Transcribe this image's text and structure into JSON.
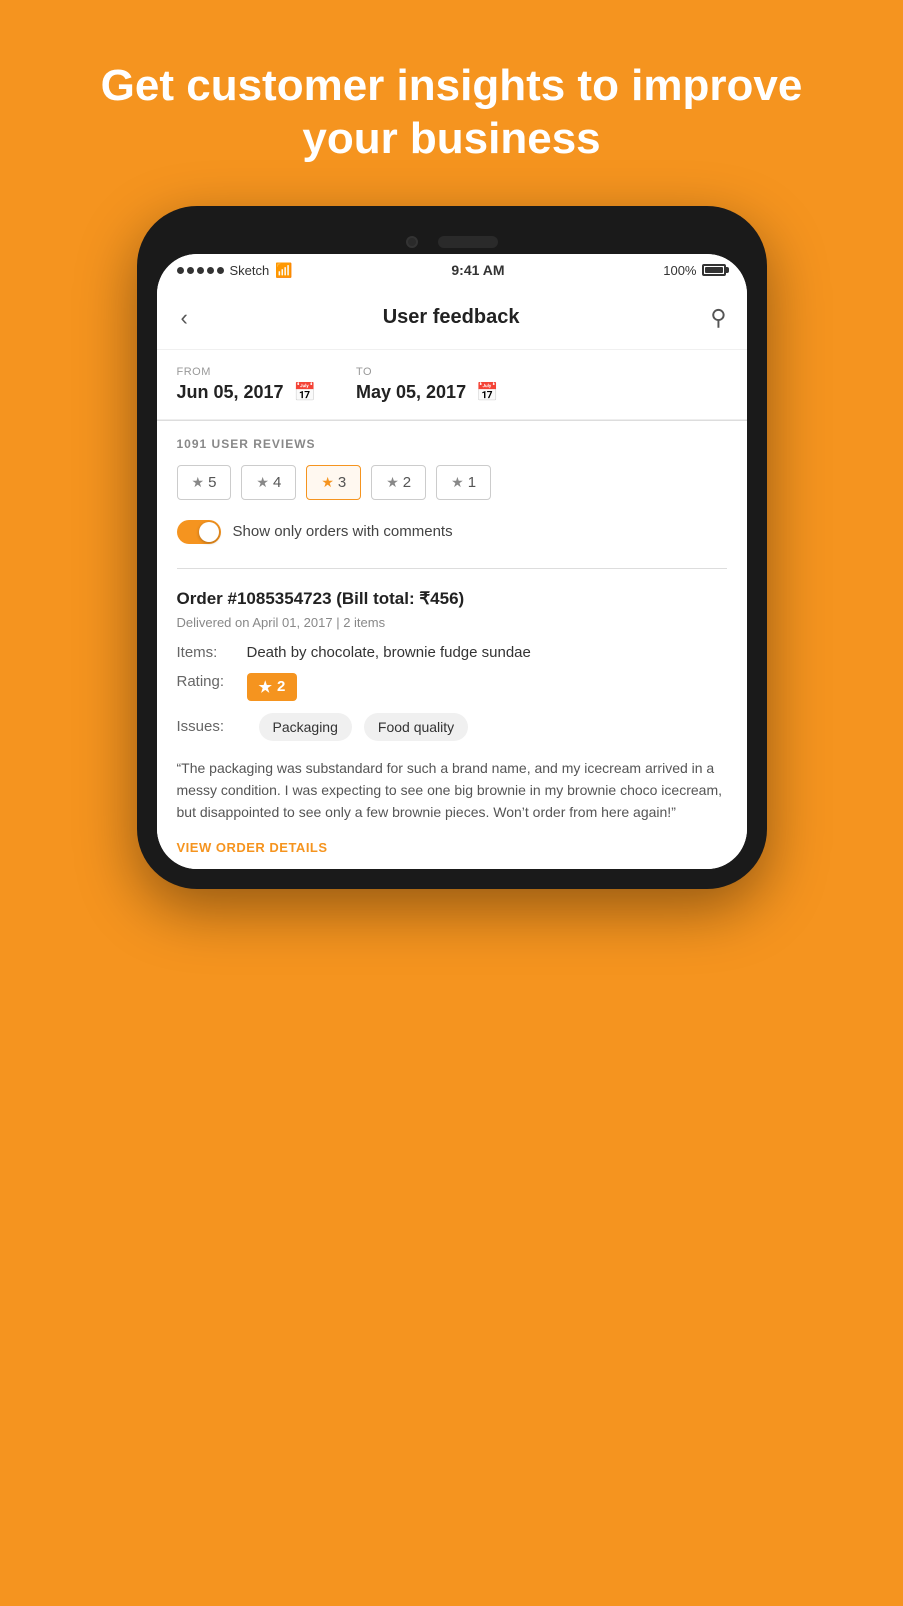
{
  "hero": {
    "headline": "Get customer insights to improve your business"
  },
  "statusBar": {
    "carrier": "Sketch",
    "time": "9:41 AM",
    "battery": "100%"
  },
  "appHeader": {
    "title": "User feedback",
    "backLabel": "‹",
    "searchLabel": "🔍"
  },
  "dateFilter": {
    "fromLabel": "FROM",
    "fromDate": "Jun 05, 2017",
    "toLabel": "TO",
    "toDate": "May 05, 2017"
  },
  "reviews": {
    "countLabel": "1091 USER REVIEWS",
    "starFilters": [
      {
        "value": "5",
        "active": false
      },
      {
        "value": "4",
        "active": false
      },
      {
        "value": "3",
        "active": true
      },
      {
        "value": "2",
        "active": false
      },
      {
        "value": "1",
        "active": false
      }
    ],
    "toggleLabel": "Show only orders with comments",
    "toggleState": "on"
  },
  "order": {
    "title": "Order #1085354723 (Bill total: ₹456)",
    "subtitle": "Delivered on April 01, 2017 | 2 items",
    "itemsLabel": "Items:",
    "itemsValue": "Death by chocolate, brownie fudge sundae",
    "ratingLabel": "Rating:",
    "ratingValue": "2",
    "issuesLabel": "Issues:",
    "issues": [
      "Packaging",
      "Food quality"
    ],
    "comment": "“The packaging was substandard for such a brand name, and my icecream arrived in a messy condition. I was expecting to see one big brownie in my brownie choco icecream, but disappointed to see only a few brownie pieces. Won’t order from here again!”",
    "viewOrderLink": "VIEW ORDER DETAILS"
  }
}
